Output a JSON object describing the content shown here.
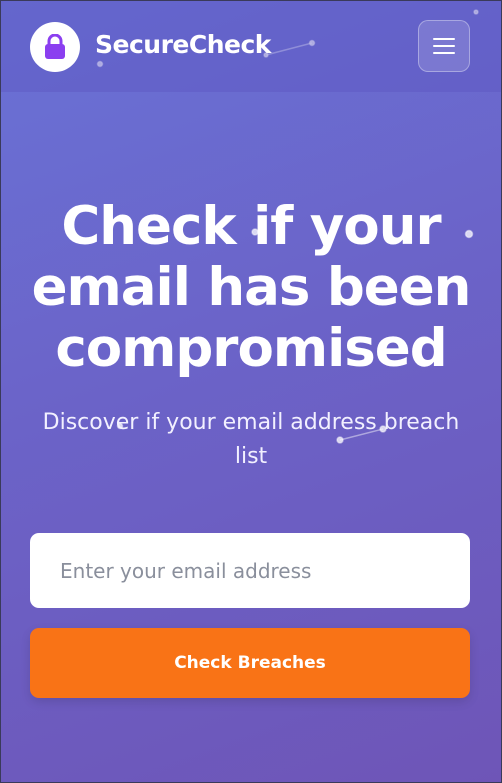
{
  "header": {
    "brand": "SecureCheck",
    "logo_icon": "lock-icon",
    "menu_icon": "hamburger-menu-icon"
  },
  "hero": {
    "title": "Check if your email has been compromised",
    "subtitle": "Discover if your email address breach list"
  },
  "form": {
    "email_placeholder": "Enter your email address",
    "email_value": "",
    "submit_label": "Check Breaches"
  },
  "colors": {
    "accent": "#f97316",
    "logo_lock": "#8b3ff0",
    "gradient_start": "#6a72d6",
    "gradient_end": "#6e55b7"
  }
}
